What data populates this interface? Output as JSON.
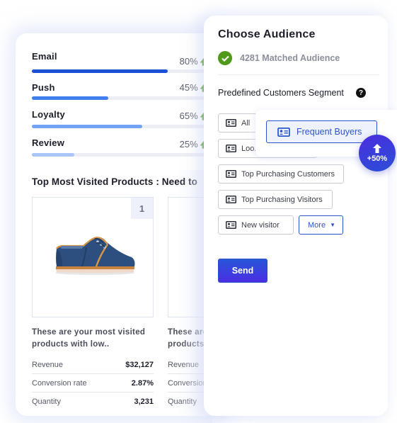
{
  "metrics": [
    {
      "label": "Email",
      "value": "80%",
      "percent": 80,
      "color": "#1a4fd6"
    },
    {
      "label": "Push",
      "value": "45%",
      "percent": 45,
      "color": "#3f7ff0"
    },
    {
      "label": "Loyalty",
      "value": "65%",
      "percent": 65,
      "color": "#72a3f7"
    },
    {
      "label": "Review",
      "value": "25%",
      "percent": 25,
      "color": "#a9c6fa"
    }
  ],
  "metric_trend_icon": "arrow-up-icon",
  "section_title": "Top Most Visited Products : Need to",
  "products": [
    {
      "rank": "1",
      "image": "blue-sneaker",
      "description": "These are your most visited products with low..",
      "stats": [
        {
          "label": "Revenue",
          "value": "$32,127"
        },
        {
          "label": "Conversion rate",
          "value": "2.87%"
        },
        {
          "label": "Quantity",
          "value": "3,231"
        }
      ]
    },
    {
      "rank": "",
      "image": "",
      "description": "These are your most visited products with low..",
      "stats": [
        {
          "label": "Revenue",
          "value": ""
        },
        {
          "label": "Conversion rate",
          "value": ""
        },
        {
          "label": "Quantity",
          "value": ""
        }
      ]
    }
  ],
  "audience": {
    "title": "Choose Audience",
    "matched": "4281 Matched Audience",
    "segment_label": "Predefined Customers Segment",
    "help": "?",
    "chips": [
      {
        "label": "All"
      },
      {
        "label": "Loo..."
      },
      {
        "label": "Top Purchasing Customers"
      },
      {
        "label": "Top Purchasing Visitors"
      },
      {
        "label": "New visitor"
      }
    ],
    "more_label": "More",
    "highlight_chip": "Frequent Buyers",
    "badge": "+50%",
    "send_label": "Send"
  },
  "colors": {
    "accent": "#2c55c9",
    "success": "#4f9a1a",
    "send_gradient_top": "#2756d8",
    "send_gradient_bottom": "#4a2ee3"
  }
}
